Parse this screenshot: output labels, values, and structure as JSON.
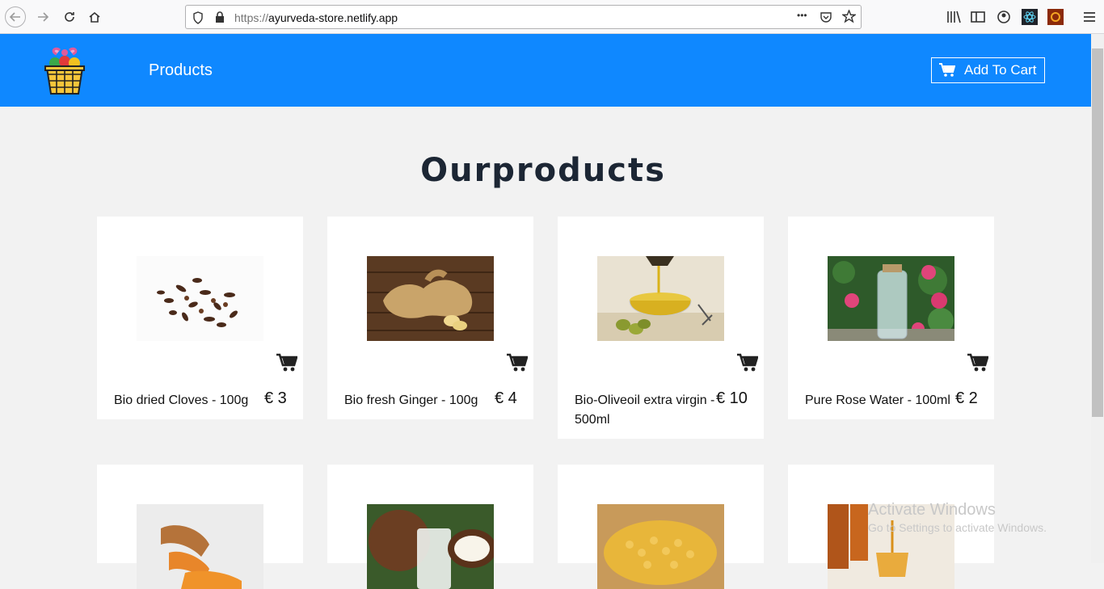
{
  "browser": {
    "url_scheme": "https://",
    "url_host": "ayurveda-store.netlify.app",
    "more_label": "•••"
  },
  "header": {
    "nav_label": "Products",
    "cart_label": "Add To Cart",
    "brand_color": "#0f88ff"
  },
  "main": {
    "title": "Ourproducts",
    "products": [
      {
        "name": "Bio dried Cloves - 100g",
        "price": "€ 3",
        "image": "cloves"
      },
      {
        "name": "Bio fresh Ginger - 100g",
        "price": "€ 4",
        "image": "ginger"
      },
      {
        "name": "Bio-Oliveoil extra virgin - 500ml",
        "price": "€ 10",
        "image": "olive-oil"
      },
      {
        "name": "Pure Rose Water - 100ml",
        "price": "€ 2",
        "image": "rose-water"
      },
      {
        "image": "turmeric"
      },
      {
        "image": "coconut"
      },
      {
        "image": "chickpeas"
      },
      {
        "image": "honey"
      }
    ]
  },
  "watermark": {
    "line1": "Activate Windows",
    "line2": "Go to Settings to activate Windows."
  }
}
